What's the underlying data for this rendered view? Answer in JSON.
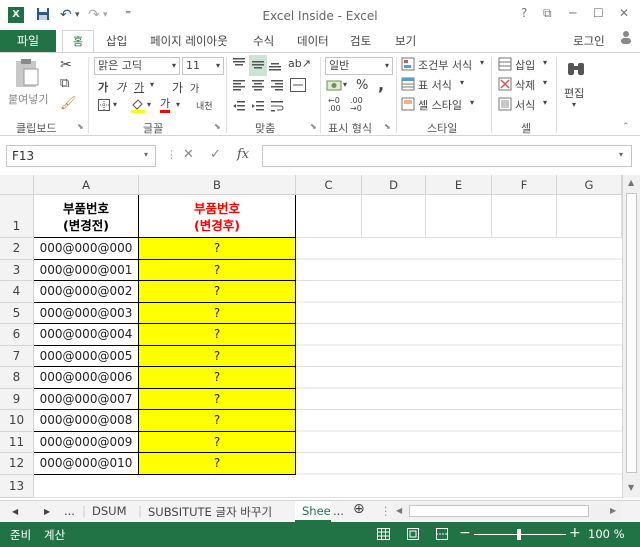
{
  "window": {
    "title": "Excel Inside - Excel",
    "help": "?",
    "restore": "⧉",
    "minimize": "─",
    "maximize": "☐",
    "close": "✕",
    "logo": "X"
  },
  "qat": {
    "save": "💾",
    "undo": "↶",
    "redo": "↷",
    "customize": "⁼"
  },
  "tabs": {
    "file": "파일",
    "home": "홈",
    "items": [
      "삽입",
      "페이지 레이아웃",
      "수식",
      "데이터",
      "검토",
      "보기"
    ],
    "login": "로그인"
  },
  "ribbon": {
    "clipboard": {
      "paste": "붙여넣기",
      "label": "클립보드"
    },
    "font": {
      "name": "맑은 고딕",
      "size": "11",
      "label": "글꼴",
      "grow": "가",
      "shrink": "가",
      "bold": "가",
      "italic": "가",
      "underline": "가",
      "strike": "가",
      "fontcolor": "가",
      "phonetic": "내천"
    },
    "alignment": {
      "label": "맞춤"
    },
    "number": {
      "format": "일반",
      "label": "표시 형식",
      "percent": "%",
      "comma": ","
    },
    "styles": {
      "conditional": "조건부 서식",
      "table": "표 서식",
      "cell": "셀 스타일",
      "label": "스타일"
    },
    "cells": {
      "insert": "삽입",
      "delete": "삭제",
      "format": "서식",
      "label": "셀"
    },
    "editing": {
      "label": "편집"
    }
  },
  "formula_bar": {
    "name_box": "F13",
    "fx": "fx",
    "cancel": "✕",
    "enter": "✓",
    "value": ""
  },
  "columns": [
    "A",
    "B",
    "C",
    "D",
    "E",
    "F",
    "G"
  ],
  "header_row": {
    "a1_line1": "부품번호",
    "a1_line2": "(변경전)",
    "b1_line1": "부품번호",
    "b1_line2": "(변경후)"
  },
  "rows": [
    {
      "num": "2",
      "a": "000@000@000",
      "b": "?"
    },
    {
      "num": "3",
      "a": "000@000@001",
      "b": "?"
    },
    {
      "num": "4",
      "a": "000@000@002",
      "b": "?"
    },
    {
      "num": "5",
      "a": "000@000@003",
      "b": "?"
    },
    {
      "num": "6",
      "a": "000@000@004",
      "b": "?"
    },
    {
      "num": "7",
      "a": "000@000@005",
      "b": "?"
    },
    {
      "num": "8",
      "a": "000@000@006",
      "b": "?"
    },
    {
      "num": "9",
      "a": "000@000@007",
      "b": "?"
    },
    {
      "num": "10",
      "a": "000@000@008",
      "b": "?"
    },
    {
      "num": "11",
      "a": "000@000@009",
      "b": "?"
    },
    {
      "num": "12",
      "a": "000@000@010",
      "b": "?"
    }
  ],
  "row1_num": "1",
  "row13_num": "13",
  "sheet_tabs": {
    "prev": "◀",
    "next": "▶",
    "ellipsis_left": "...",
    "tab1": "DSUM",
    "tab2": "SUBSITUTE 글자 바꾸기",
    "tab3": "Shee",
    "ellipsis_right": "...",
    "add": "⊕"
  },
  "status": {
    "ready": "준비",
    "calc": "계산",
    "zoom": "100 %",
    "minus": "−",
    "plus": "+"
  },
  "colors": {
    "accent": "#217346",
    "highlight": "#ffff00",
    "header_red": "#ff0000"
  }
}
